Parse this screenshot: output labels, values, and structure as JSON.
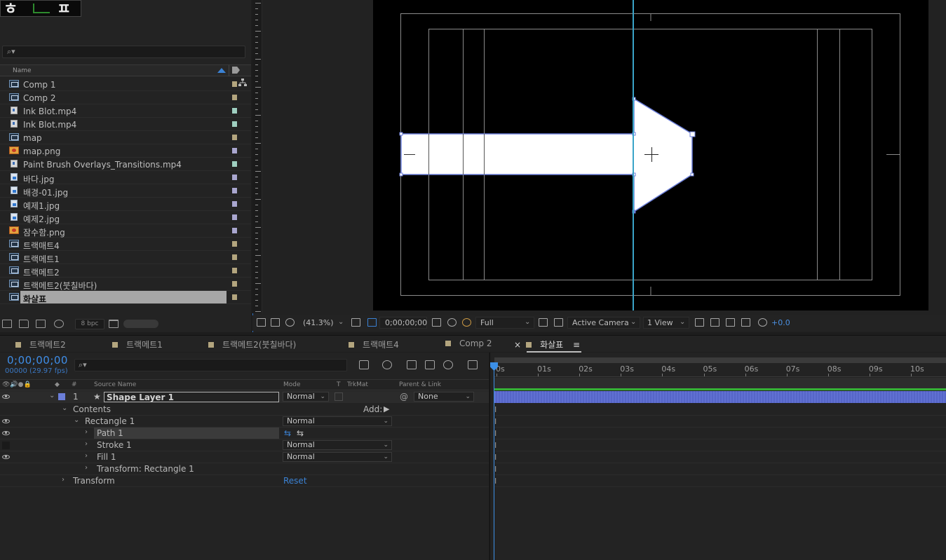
{
  "project": {
    "search_placeholder": "",
    "column_name": "Name",
    "bpc": "8 bpc",
    "items": [
      {
        "label": "Comp 1",
        "type": "comp",
        "color": "#b3a57e"
      },
      {
        "label": "Comp 2",
        "type": "comp",
        "color": "#b3a57e"
      },
      {
        "label": "Ink Blot.mp4",
        "type": "movie",
        "color": "#9fcfc0"
      },
      {
        "label": "Ink Blot.mp4",
        "type": "movie",
        "color": "#9fcfc0"
      },
      {
        "label": "map",
        "type": "comp",
        "color": "#b3a57e"
      },
      {
        "label": "map.png",
        "type": "png",
        "color": "#a9a6cf"
      },
      {
        "label": "Paint Brush Overlays_Transitions.mp4",
        "type": "movie",
        "color": "#9fcfc0"
      },
      {
        "label": "바다.jpg",
        "type": "image",
        "color": "#a9a6cf"
      },
      {
        "label": "배경-01.jpg",
        "type": "image",
        "color": "#a9a6cf"
      },
      {
        "label": "예제1.jpg",
        "type": "image",
        "color": "#a9a6cf"
      },
      {
        "label": "예제2.jpg",
        "type": "image",
        "color": "#a9a6cf"
      },
      {
        "label": "잠수함.png",
        "type": "png",
        "color": "#a9a6cf"
      },
      {
        "label": "트랙매트4",
        "type": "comp",
        "color": "#b3a57e"
      },
      {
        "label": "트랙메트1",
        "type": "comp",
        "color": "#b3a57e"
      },
      {
        "label": "트랙메트2",
        "type": "comp",
        "color": "#b3a57e"
      },
      {
        "label": "트랙메트2(붓칠바다)",
        "type": "comp",
        "color": "#b3a57e"
      },
      {
        "label": "화살표",
        "type": "comp",
        "color": "#b3a57e",
        "selected": true
      }
    ]
  },
  "viewer": {
    "zoom": "(41.3%)",
    "timecode": "0;00;00;00",
    "resolution": "Full",
    "camera": "Active Camera",
    "views": "1 View",
    "exposure": "+0.0"
  },
  "timeline": {
    "tabs": [
      {
        "label": "트랙메트2"
      },
      {
        "label": "트랙메트1"
      },
      {
        "label": "트랙메트2(붓칠바다)"
      },
      {
        "label": "트랙매트4"
      },
      {
        "label": "Comp 2"
      },
      {
        "label": "화살표",
        "active": true
      }
    ],
    "close_symbol": "×",
    "menu_symbol": "≡",
    "current_time": "0;00;00;00",
    "fps": "00000 (29.97 fps)",
    "columns": {
      "hash": "#",
      "source_name": "Source Name",
      "mode": "Mode",
      "t": "T",
      "trkmat": "TrkMat",
      "parent": "Parent & Link"
    },
    "layer": {
      "number": "1",
      "name": "Shape Layer 1",
      "mode": "Normal",
      "parent": "None"
    },
    "properties": {
      "contents": "Contents",
      "add_label": "Add:",
      "rectangle": "Rectangle 1",
      "rectangle_mode": "Normal",
      "path": "Path 1",
      "stroke": "Stroke 1",
      "stroke_mode": "Normal",
      "fill": "Fill 1",
      "fill_mode": "Normal",
      "transform_rect": "Transform: Rectangle 1",
      "transform": "Transform",
      "reset": "Reset"
    },
    "ruler_labels": [
      "0s",
      "01s",
      "02s",
      "03s",
      "04s",
      "05s",
      "06s",
      "07s",
      "08s",
      "09s",
      "10s"
    ]
  }
}
